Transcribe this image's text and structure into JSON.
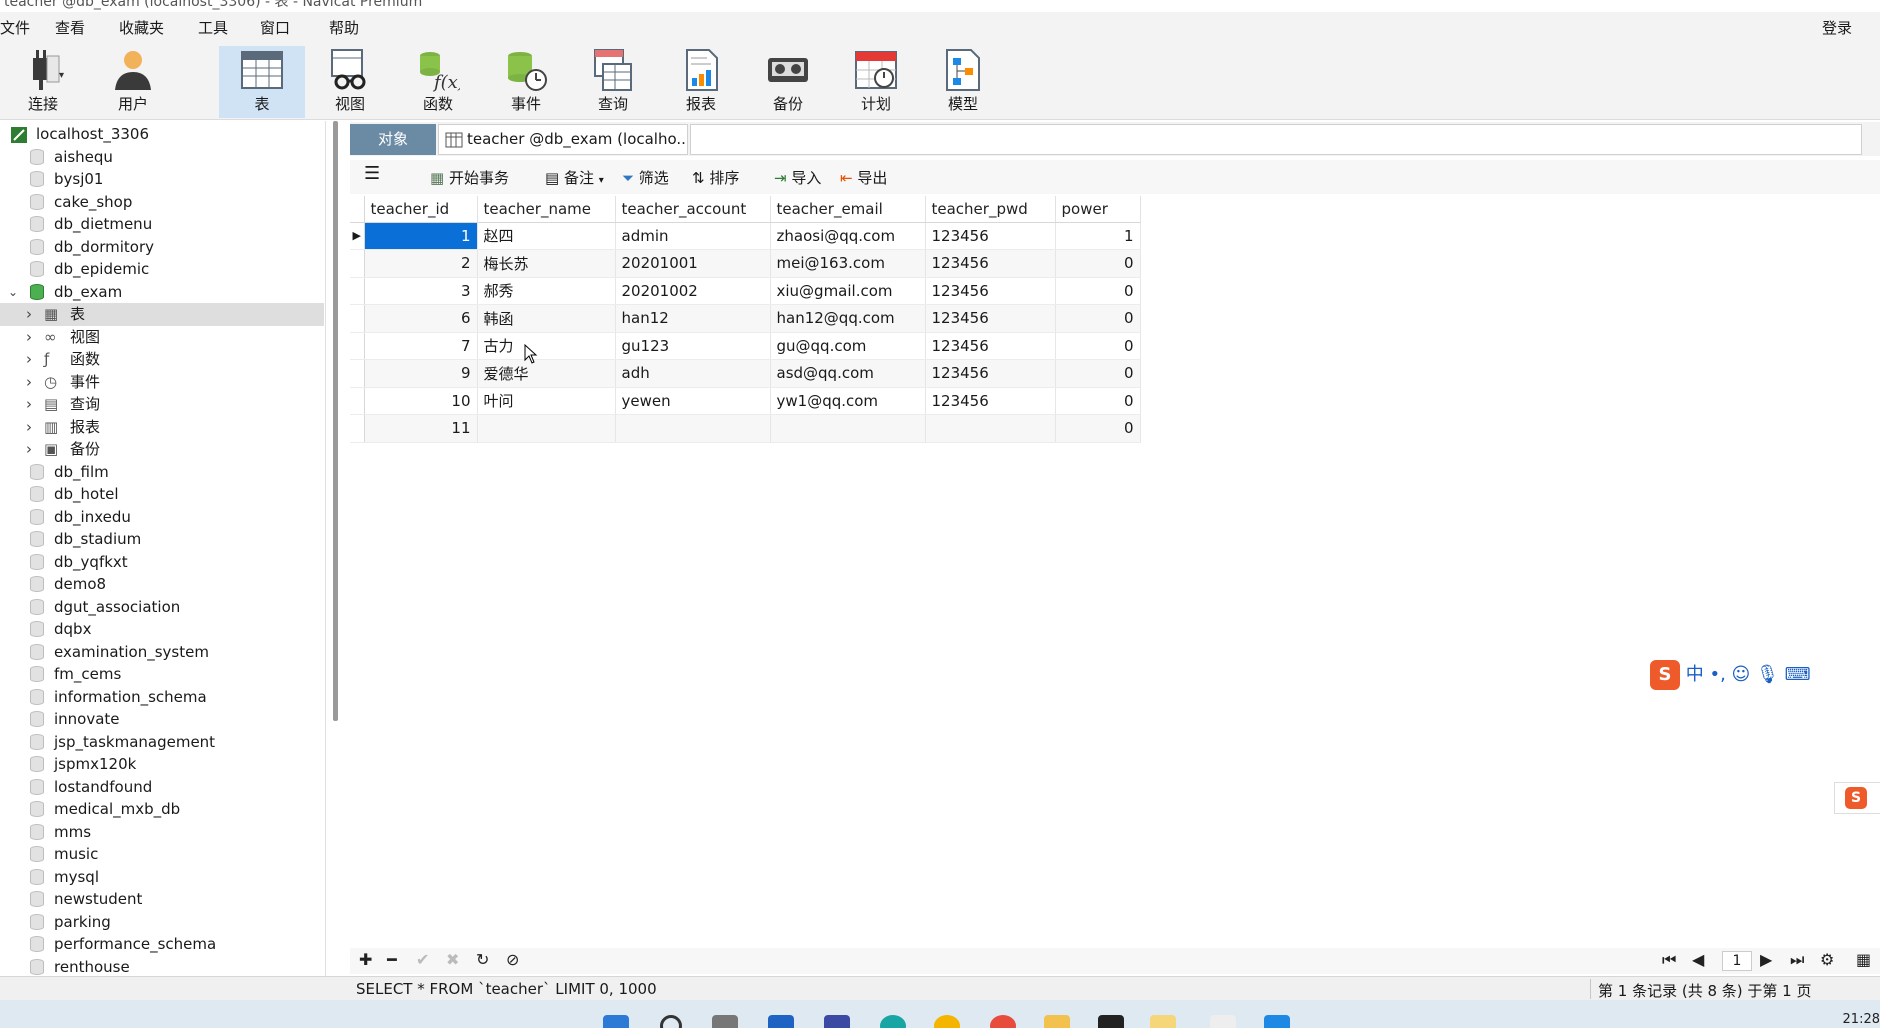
{
  "window": {
    "title": "teacher @db_exam (localhost_3306) - 表 - Navicat Premium"
  },
  "menu": {
    "items": [
      "文件",
      "查看",
      "收藏夹",
      "工具",
      "窗口",
      "帮助"
    ],
    "login": "登录"
  },
  "toolbar": {
    "buttons": [
      {
        "label": "连接",
        "icon": "plug-icon"
      },
      {
        "label": "用户",
        "icon": "user-icon"
      },
      {
        "label": "表",
        "icon": "table-icon"
      },
      {
        "label": "视图",
        "icon": "glasses-icon"
      },
      {
        "label": "函数",
        "icon": "function-icon"
      },
      {
        "label": "事件",
        "icon": "event-clock-icon"
      },
      {
        "label": "查询",
        "icon": "query-icon"
      },
      {
        "label": "报表",
        "icon": "report-icon"
      },
      {
        "label": "备份",
        "icon": "backup-icon"
      },
      {
        "label": "计划",
        "icon": "calendar-icon"
      },
      {
        "label": "模型",
        "icon": "model-icon"
      }
    ],
    "active": "表"
  },
  "sidebar": {
    "connection": "localhost_3306",
    "databases_before": [
      "aishequ",
      "bysj01",
      "cake_shop",
      "db_dietmenu",
      "db_dormitory",
      "db_epidemic"
    ],
    "open_db": "db_exam",
    "open_db_children": [
      "表",
      "视图",
      "函数",
      "事件",
      "查询",
      "报表",
      "备份"
    ],
    "selected_child": "表",
    "databases_after": [
      "db_film",
      "db_hotel",
      "db_inxedu",
      "db_stadium",
      "db_yqfkxt",
      "demo8",
      "dgut_association",
      "dqbx",
      "examination_system",
      "fm_cems",
      "information_schema",
      "innovate",
      "jsp_taskmanagement",
      "jspmx120k",
      "lostandfound",
      "medical_mxb_db",
      "mms",
      "music",
      "mysql",
      "newstudent",
      "parking",
      "performance_schema",
      "renthouse"
    ]
  },
  "tabs": {
    "objects": "对象",
    "active_tab": "teacher @db_exam (localho..."
  },
  "gridbar": {
    "menu_icon": "hamburger-icon",
    "begin_transaction": "开始事务",
    "memo": "备注",
    "filter": "筛选",
    "sort": "排序",
    "import": "导入",
    "export": "导出"
  },
  "grid": {
    "columns": [
      "teacher_id",
      "teacher_name",
      "teacher_account",
      "teacher_email",
      "teacher_pwd",
      "power"
    ],
    "rows": [
      [
        "1",
        "赵四",
        "admin",
        "zhaosi@qq.com",
        "123456",
        "1"
      ],
      [
        "2",
        "梅长苏",
        "20201001",
        "mei@163.com",
        "123456",
        "0"
      ],
      [
        "3",
        "郝秀",
        "20201002",
        "xiu@gmail.com",
        "123456",
        "0"
      ],
      [
        "6",
        "韩函",
        "han12",
        "han12@qq.com",
        "123456",
        "0"
      ],
      [
        "7",
        "古力",
        "gu123",
        "gu@qq.com",
        "123456",
        "0"
      ],
      [
        "9",
        "爱德华",
        "adh",
        "asd@qq.com",
        "123456",
        "0"
      ],
      [
        "10",
        "叶问",
        "yewen",
        "yw1@qq.com",
        "123456",
        "0"
      ],
      [
        "11",
        "",
        "",
        "",
        "",
        "0"
      ]
    ],
    "selected_row": 0
  },
  "footer": {
    "page": "1"
  },
  "status": {
    "sql": "SELECT * FROM `teacher` LIMIT 0, 1000",
    "records": "第 1 条记录 (共 8 条) 于第 1 页"
  },
  "ime": {
    "text": "中 •,"
  },
  "clock": "21:28",
  "colors": {
    "accent": "#0a6fd6",
    "objects_tab": "#6b8ba4",
    "toolbar_active": "#cfe3f5"
  }
}
